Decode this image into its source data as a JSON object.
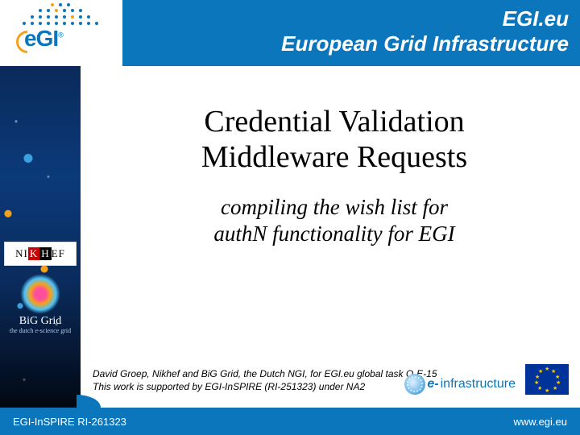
{
  "header": {
    "org": "EGI.eu",
    "tagline": "European Grid Infrastructure",
    "logo_text": "eGI",
    "logo_reg": "®"
  },
  "main": {
    "title_line1": "Credential Validation",
    "title_line2": "Middleware Requests",
    "subtitle_line1": "compiling the wish list for",
    "subtitle_line2": "authN functionality for EGI"
  },
  "partners": {
    "nikhef": {
      "n": "NI",
      "k": "K",
      "h": "H",
      "ef": "EF"
    },
    "biggrid": {
      "name": "BiG Grid",
      "sub": "the dutch e-science grid"
    }
  },
  "credits": {
    "line1": "David Groep, Nikhef and BiG Grid, the Dutch NGI, for EGI.eu global task O-E-15",
    "line2": "This work is supported by EGI-InSPIRE (RI-251323) under NA2"
  },
  "einfra": {
    "prefix": "e-",
    "word": "infrastructure"
  },
  "footer": {
    "left": "EGI-InSPIRE RI-261323",
    "right": "www.egi.eu"
  }
}
